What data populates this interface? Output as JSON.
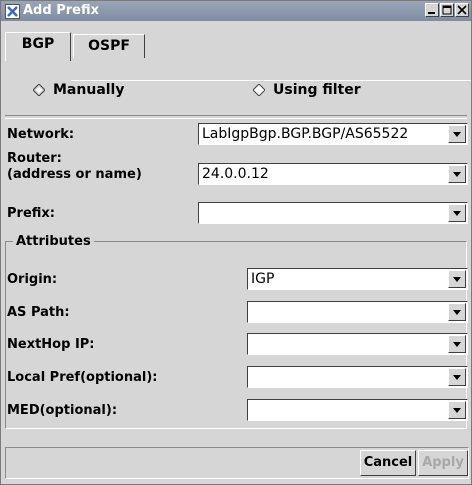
{
  "window": {
    "title": "Add Prefix"
  },
  "tabs": [
    {
      "label": "BGP"
    },
    {
      "label": "OSPF"
    }
  ],
  "mode": {
    "options": [
      {
        "label": "Manually"
      },
      {
        "label": "Using filter"
      }
    ]
  },
  "fields": {
    "network": {
      "label": "Network:",
      "value": "LabIgpBgp.BGP.BGP/AS65522"
    },
    "router": {
      "label_line1": "Router:",
      "label_line2": "(address or name)",
      "value": "24.0.0.12"
    },
    "prefix": {
      "label": "Prefix:",
      "value": ""
    }
  },
  "attributes": {
    "title": "Attributes",
    "origin": {
      "label": "Origin:",
      "value": "IGP"
    },
    "as_path": {
      "label": "AS Path:",
      "value": ""
    },
    "nexthop": {
      "label": "NextHop IP:",
      "value": ""
    },
    "local_pref": {
      "label": "Local Pref(optional):",
      "value": ""
    },
    "med": {
      "label": "MED(optional):",
      "value": ""
    }
  },
  "buttons": {
    "cancel": "Cancel",
    "apply": "Apply"
  }
}
